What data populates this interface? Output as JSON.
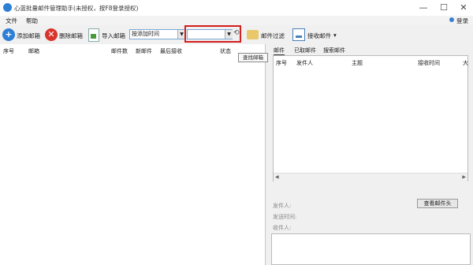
{
  "window": {
    "title": "心蓝批量邮件管理助手(未授权，按F8登录授权)",
    "minimize": "—",
    "maximize": "☐",
    "close": "✕"
  },
  "menu": {
    "file": "文件",
    "help": "帮助",
    "login": "登录"
  },
  "toolbar": {
    "add_mailbox": "添加邮箱",
    "delete_mailbox": "删除邮箱",
    "import_mailbox": "导入邮箱",
    "sort_select": "按添加时间",
    "search_value": "",
    "refresh_icon": "⟲",
    "mail_filter": "邮件过滤",
    "receive_mail": "接收邮件",
    "receive_mail_arrow": "▾"
  },
  "tooltip": "查找邮箱",
  "left_table": {
    "columns": [
      "序号",
      "邮箱",
      "邮件数",
      "新邮件",
      "最后接收",
      "状态"
    ]
  },
  "right_tabs": [
    "邮件",
    "已取邮件",
    "搜索邮件"
  ],
  "mail_table": {
    "columns": [
      "序号",
      "发件人",
      "主题",
      "接收时间",
      "大"
    ]
  },
  "scroll": {
    "left_arrow": "◀",
    "right_arrow": "▶"
  },
  "mail_info": {
    "sender_label": "发件人:",
    "send_time_label": "发送时间:",
    "recipient_label": "收件人:"
  },
  "view_header_button": "查看邮件头",
  "colors": {
    "accent_blue": "#2d7fd6",
    "delete_red": "#d9342b",
    "highlight_red": "#d21f1f"
  }
}
